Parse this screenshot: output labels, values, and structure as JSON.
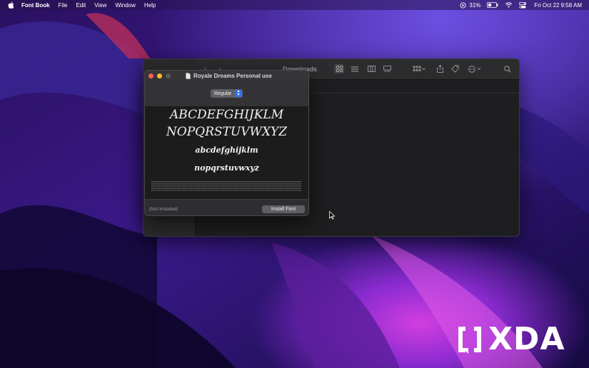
{
  "menubar": {
    "app_name": "Font Book",
    "items": [
      "File",
      "Edit",
      "View",
      "Window",
      "Help"
    ],
    "battery": "31%",
    "clock": "Fri Oct 22  9:58 AM"
  },
  "finder": {
    "title": "Downloads"
  },
  "font_window": {
    "title": "Royale Dreams Personal use",
    "style_select": "Regular",
    "preview_uppercase_1": "ABCDEFGHIJKLM",
    "preview_uppercase_2": "NOPQRSTUVWXYZ",
    "preview_lowercase_1": "abcdefghijklm",
    "preview_lowercase_2": "nopqrstuvwxyz",
    "status": "(Not Installed)",
    "install_button": "Install Font"
  },
  "watermark": {
    "text": "XDA"
  },
  "colors": {
    "close": "#fe5f57",
    "minimize": "#febc2e",
    "select_accent": "#2f6ff0"
  }
}
